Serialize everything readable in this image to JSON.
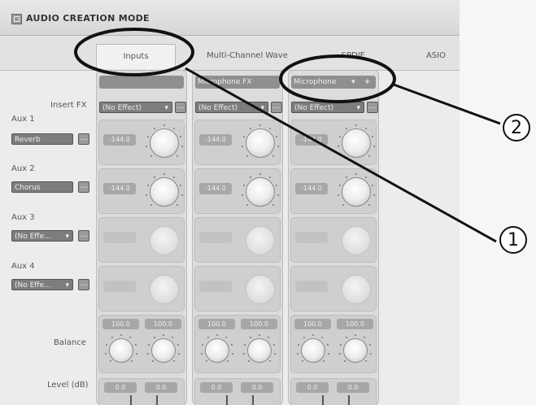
{
  "window": {
    "title": "AUDIO CREATION MODE"
  },
  "tabs": [
    {
      "label": "Inputs",
      "active": true
    },
    {
      "label": "Multi-Channel Wave",
      "active": false
    },
    {
      "label": "SPDIF",
      "active": false
    },
    {
      "label": "ASIO",
      "active": false
    }
  ],
  "labels": {
    "insert_fx": "Insert FX",
    "aux1": "Aux 1",
    "aux2": "Aux 2",
    "aux3": "Aux 3",
    "aux4": "Aux 4",
    "balance": "Balance",
    "level": "Level (dB)"
  },
  "aux_effects": [
    "Reverb",
    "Chorus",
    "(No Effe...",
    "(No Effe..."
  ],
  "channels": [
    {
      "header": "",
      "insert": "(No Effect)",
      "send1": "-144.0",
      "send2": "-144.0",
      "bal_left": "100.0",
      "bal_right": "100.0",
      "level_left": "0.0",
      "level_right": "0.0"
    },
    {
      "header": "Microphone FX",
      "insert": "(No Effect)",
      "send1": "-144.0",
      "send2": "-144.0",
      "bal_left": "100.0",
      "bal_right": "100.0",
      "level_left": "0.0",
      "level_right": "0.0"
    },
    {
      "header": "Microphone",
      "insert": "(No Effect)",
      "send1": "-144.0",
      "send2": "-144.0",
      "bal_left": "100.0",
      "bal_right": "100.0",
      "level_left": "0.0",
      "level_right": "0.0"
    }
  ],
  "glyphs": {
    "dropdown": "▾",
    "more": "...",
    "add": "+"
  },
  "callouts": [
    {
      "number": "1"
    },
    {
      "number": "2"
    }
  ]
}
